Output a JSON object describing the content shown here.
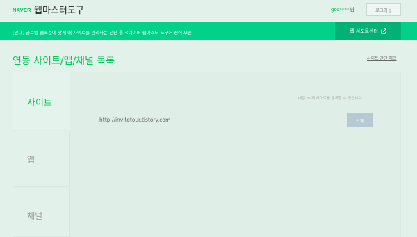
{
  "header": {
    "brand": "NAVER",
    "title": "웹마스터도구",
    "user_name": "gos****",
    "user_suffix": "님",
    "logout_label": "로그아웃"
  },
  "notice": {
    "text": "[안내] 글로벌 웹표준에 맞게 내 사이트를 관리하는 진단 툴 <네이버 웹마스터 도구> 정식 오픈",
    "support_label": "웹 서포트센터",
    "support_icon": "external-link-icon"
  },
  "page": {
    "title": "연동 사이트/앱/채널 목록",
    "verify_link": "사이트 간단 체크"
  },
  "tabs": {
    "site": "사이트",
    "app": "앱",
    "channel": "채널"
  },
  "site_panel": {
    "limit_note": "내일 30개 사이트를 등록할 수 있습니다.",
    "sites": [
      {
        "url": "http://invitetour.tistory.com",
        "delete_label": "삭제"
      }
    ]
  },
  "colors": {
    "brand_green": "#03c75a",
    "notice_bg": "#00d28a",
    "support_bg": "#03b075",
    "page_bg": "#e2f1ea",
    "delete_bg": "#b7c9d3"
  }
}
